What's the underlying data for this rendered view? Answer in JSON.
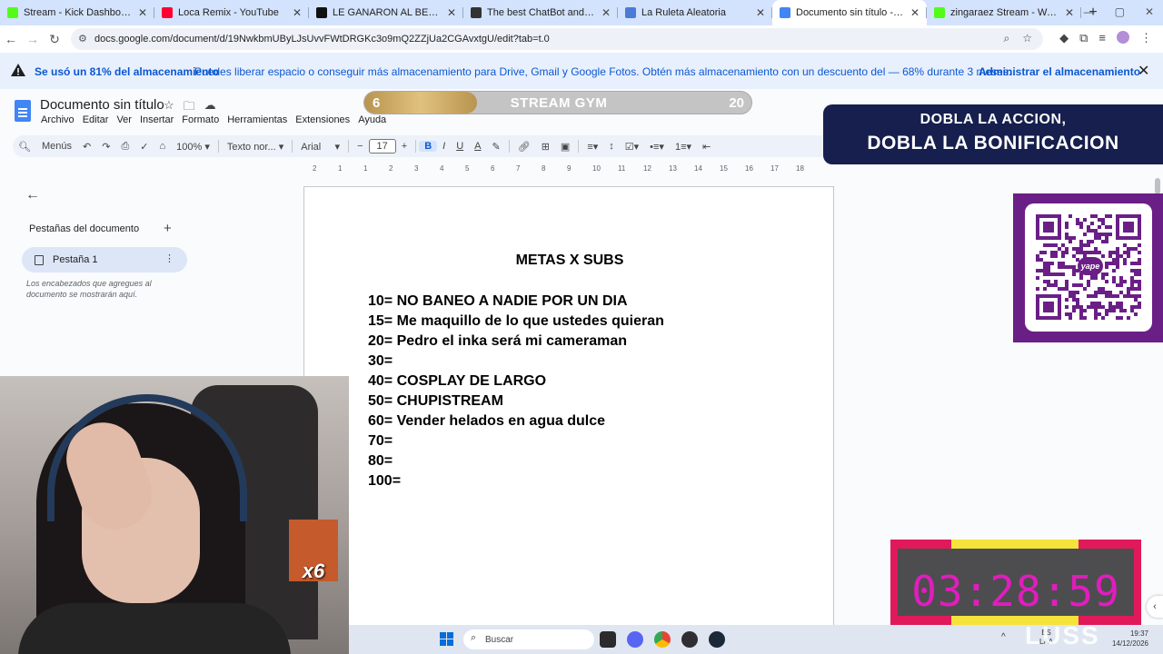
{
  "browser": {
    "tabs": [
      {
        "label": "Stream - Kick Dashboard",
        "color": "#53fc18",
        "active": false
      },
      {
        "label": "Loca Remix - YouTube",
        "color": "#ff0033",
        "active": false
      },
      {
        "label": "LE GANARON AL BEBOTISMOC",
        "color": "#111111",
        "active": false
      },
      {
        "label": "The best ChatBot and Widgets",
        "color": "#333333",
        "active": false
      },
      {
        "label": "La Ruleta Aleatoria",
        "color": "#4a7bd6",
        "active": false
      },
      {
        "label": "Documento sin título - Docum",
        "color": "#4285f4",
        "active": true
      },
      {
        "label": "zingaraez Stream - Watch Live",
        "color": "#53fc18",
        "active": false
      }
    ],
    "new_tab": "+",
    "url": "docs.google.com/document/d/19NwkbmUByLJsUvvFWtDRGKc3o9mQ2ZZjUa2CGAvxtgU/edit?tab=t.0"
  },
  "banner": {
    "bold": "Se usó un 81% del almacenamiento",
    "text": "Puedes liberar espacio o conseguir más almacenamiento para Drive, Gmail y Google Fotos. Obtén más almacenamiento con un descuento del — 68% durante 3 meses.",
    "link": "Administrar el almacenamiento",
    "storage_used_percent": 81
  },
  "docs": {
    "title": "Documento sin título",
    "menu": [
      "Archivo",
      "Editar",
      "Ver",
      "Insertar",
      "Formato",
      "Herramientas",
      "Extensiones",
      "Ayuda"
    ],
    "toolbar": {
      "menus_label": "Menús",
      "zoom": "100%",
      "style": "Texto nor...",
      "font": "Arial",
      "font_size": "17",
      "bold": "B",
      "italic": "I",
      "underline": "U",
      "text_color": "A"
    },
    "ruler": [
      "2",
      "1",
      "1",
      "2",
      "3",
      "4",
      "5",
      "6",
      "7",
      "8",
      "9",
      "10",
      "11",
      "12",
      "13",
      "14",
      "15",
      "16",
      "17",
      "18"
    ],
    "sidebar": {
      "title": "Pestañas del documento",
      "add": "+",
      "tab_label": "Pestaña 1",
      "note": "Los encabezados que agregues al documento se mostrarán aquí."
    },
    "content": {
      "heading": "METAS X SUBS",
      "lines": [
        "10= NO BANEO A NADIE POR UN DIA",
        "15= Me maquillo de lo que ustedes quieran",
        "20= Pedro el inka será mi cameraman",
        "30=",
        "40= COSPLAY DE LARGO",
        "50= CHUPISTREAM",
        "60= Vender helados en agua dulce",
        "70=",
        "80=",
        "100="
      ]
    }
  },
  "overlays": {
    "gym": {
      "left_value": "6",
      "title": "STREAM GYM",
      "right_value": "20",
      "progress": 0.29
    },
    "promo": {
      "line1": "DOBLA LA ACCION,",
      "line2": "DOBLA LA BONIFICACION"
    },
    "qr_logo": "yape",
    "timer": "03:28:59",
    "webcam_badge": "x6",
    "watermark": "LUSS"
  },
  "taskbar": {
    "search_placeholder": "Buscar",
    "lang_top": "ES",
    "lang_bottom": "LAA",
    "time": "19:37",
    "date": "14/12/2026"
  }
}
